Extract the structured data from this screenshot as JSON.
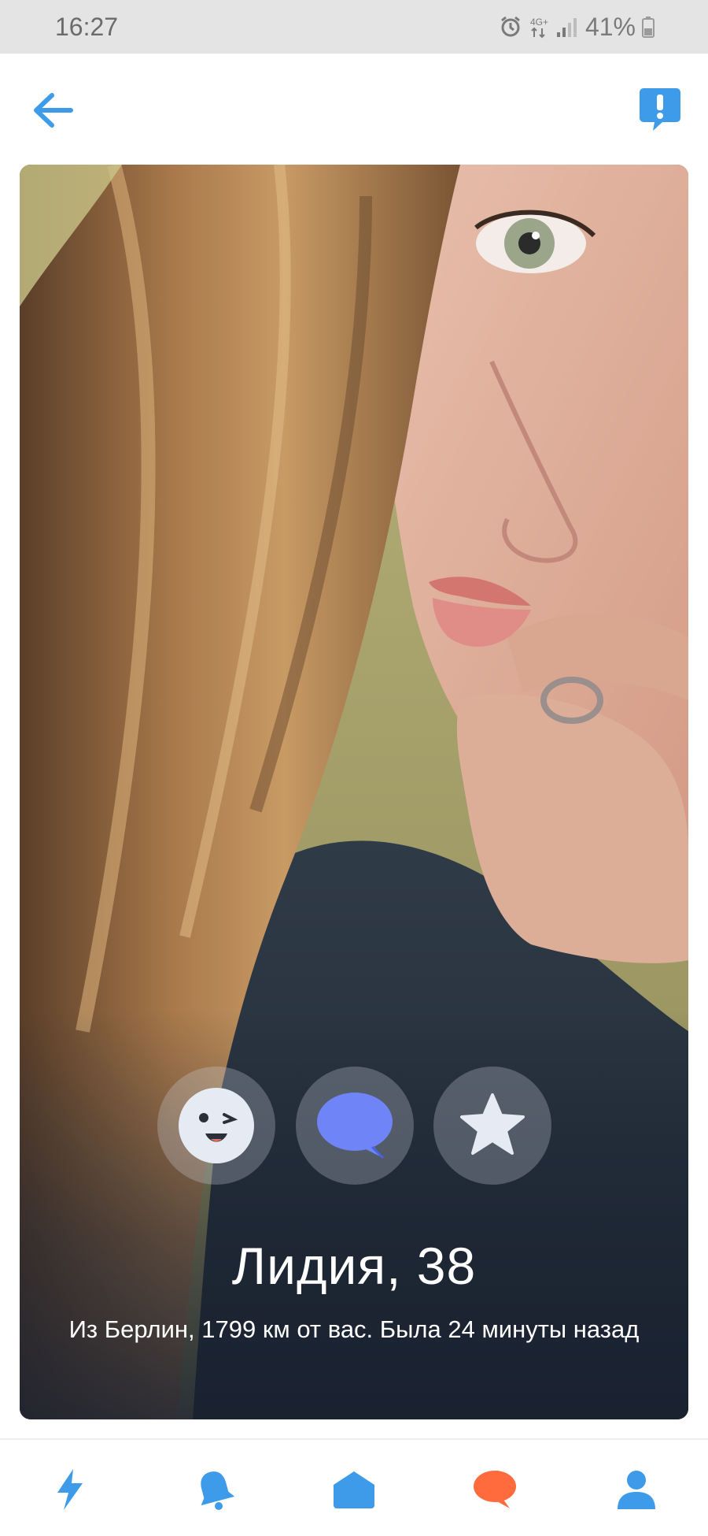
{
  "status_bar": {
    "time": "16:27",
    "battery": "41%",
    "icons": [
      "alarm-icon",
      "network-4g-icon",
      "signal-icon",
      "battery-icon"
    ]
  },
  "top_bar": {
    "back_icon": "arrow-left-icon",
    "report_icon": "report-icon"
  },
  "profile": {
    "name_age": "Лидия, 38",
    "details": "Из Берлин, 1799 км от вас. Была 24 минуты назад",
    "actions": [
      {
        "name": "wink",
        "icon": "wink-face-icon"
      },
      {
        "name": "message",
        "icon": "chat-bubble-icon"
      },
      {
        "name": "favorite",
        "icon": "star-icon"
      }
    ]
  },
  "bottom_nav": {
    "items": [
      {
        "name": "flash",
        "icon": "lightning-icon",
        "color": "#3d9be9"
      },
      {
        "name": "notifications",
        "icon": "bell-icon",
        "color": "#3d9be9"
      },
      {
        "name": "home",
        "icon": "home-icon",
        "color": "#3d9be9"
      },
      {
        "name": "messages",
        "icon": "chat-icon",
        "color": "#ff6b3d"
      },
      {
        "name": "profile",
        "icon": "user-icon",
        "color": "#3d9be9"
      }
    ]
  },
  "colors": {
    "accent": "#3d9be9",
    "active_tab": "#ff6b3d",
    "message_button": "#6f84f6"
  }
}
